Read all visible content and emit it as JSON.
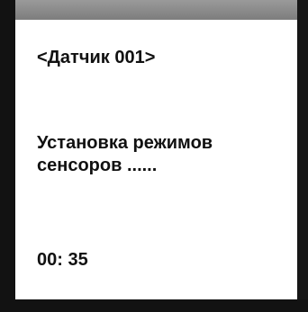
{
  "screen": {
    "title": "<Датчик 001>",
    "message_line1": "Установка режимов",
    "message_line2": "сенсоров ......",
    "timer": "00: 35"
  },
  "colors": {
    "bezel_top": "#8a8a8a",
    "bezel": "#121212",
    "screen_bg": "#ffffff",
    "text": "#111111"
  }
}
